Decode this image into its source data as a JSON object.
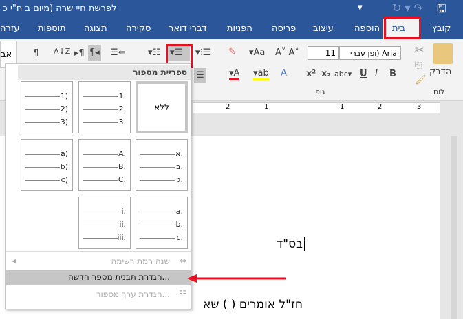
{
  "title": "לפרשת חיי שרה (מיום ב ח\"י כ",
  "tabs": [
    "קובץ",
    "בית",
    "הוספה",
    "עיצוב",
    "פריסה",
    "הפניות",
    "דברי דואר",
    "סקירה",
    "תצוגה",
    "תוספות",
    "עזרה"
  ],
  "active_tab": "בית",
  "ribbon": {
    "paste": "הדבק",
    "clipboard": "לוח",
    "font_group": "גופן",
    "font_name": "Arial (ופן עברי",
    "font_size": "11",
    "left_cut": "אב"
  },
  "numbering_library": {
    "header": "ספריית מספור",
    "none": "ללא",
    "formats": [
      [
        "1.",
        "2.",
        "3."
      ],
      [
        "1)",
        "2)",
        "3)"
      ],
      [
        "א.",
        "ב.",
        "ג."
      ],
      [
        "A.",
        "B.",
        "C."
      ],
      [
        "a)",
        "b)",
        "c)"
      ],
      [
        "a.",
        "b.",
        "c."
      ],
      [
        "i.",
        "ii.",
        "iii."
      ]
    ],
    "menu": [
      {
        "label": "שנה רמת רשימה",
        "enabled": false
      },
      {
        "label": "הגדרת תבנית מספר חדשה...",
        "enabled": true,
        "highlighted": true
      },
      {
        "label": "הגדרת ערך מספור...",
        "enabled": false
      }
    ]
  },
  "document": {
    "line1": "בס\"ד",
    "line2": "חז\"ל אומרים ( ) שא"
  },
  "ruler": [
    "3",
    "2",
    "1",
    "1",
    "2"
  ],
  "colors": {
    "title": "#2b579a",
    "highlight": "#e81123"
  }
}
